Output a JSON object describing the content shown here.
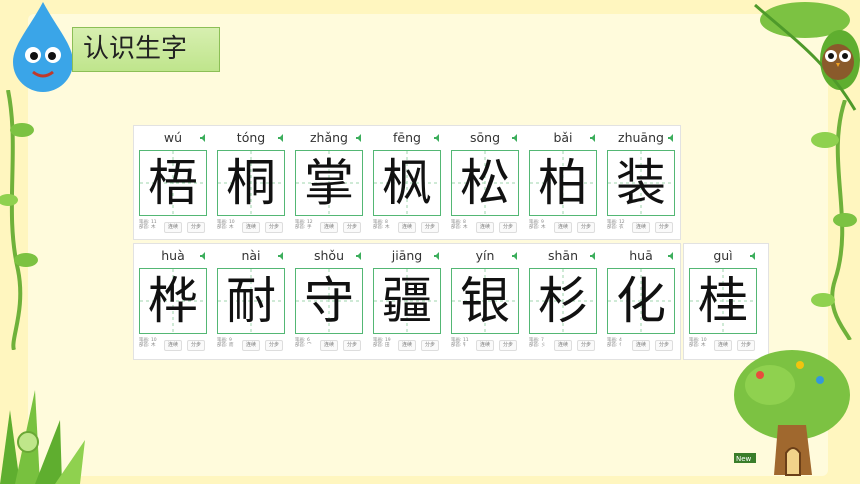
{
  "header": {
    "title": "认识生字"
  },
  "colors": {
    "grid_border": "#53b774",
    "tag_bg": "#c5e89a",
    "background": "#fff6bf"
  },
  "cards": [
    {
      "pinyin": "wú",
      "char": "梧",
      "strokes": "笔画: 11",
      "radical": "部首: 木"
    },
    {
      "pinyin": "tóng",
      "char": "桐",
      "strokes": "笔画: 10",
      "radical": "部首: 木"
    },
    {
      "pinyin": "zhǎng",
      "char": "掌",
      "strokes": "笔画: 12",
      "radical": "部首: 手"
    },
    {
      "pinyin": "fēng",
      "char": "枫",
      "strokes": "笔画: 8",
      "radical": "部首: 木"
    },
    {
      "pinyin": "sōng",
      "char": "松",
      "strokes": "笔画: 8",
      "radical": "部首: 木"
    },
    {
      "pinyin": "bǎi",
      "char": "柏",
      "strokes": "笔画: 9",
      "radical": "部首: 木"
    },
    {
      "pinyin": "zhuāng",
      "char": "装",
      "strokes": "笔画: 12",
      "radical": "部首: 衣"
    },
    {
      "pinyin": "huà",
      "char": "桦",
      "strokes": "笔画: 10",
      "radical": "部首: 木"
    },
    {
      "pinyin": "nài",
      "char": "耐",
      "strokes": "笔画: 9",
      "radical": "部首: 而"
    },
    {
      "pinyin": "shǒu",
      "char": "守",
      "strokes": "笔画: 6",
      "radical": "部首: 宀"
    },
    {
      "pinyin": "jiāng",
      "char": "疆",
      "strokes": "笔画: 19",
      "radical": "部首: 田"
    },
    {
      "pinyin": "yín",
      "char": "银",
      "strokes": "笔画: 11",
      "radical": "部首: 钅"
    },
    {
      "pinyin": "shān",
      "char": "杉",
      "strokes": "笔画: 7",
      "radical": "部首: 彡"
    },
    {
      "pinyin": "huā",
      "char": "化",
      "strokes": "笔画: 4",
      "radical": "部首: 亻"
    },
    {
      "pinyin": "guì",
      "char": "桂",
      "strokes": "笔画: 10",
      "radical": "部首: 木"
    }
  ],
  "buttons": {
    "stroke": "连续",
    "step": "分步"
  },
  "tree_sign": "New"
}
